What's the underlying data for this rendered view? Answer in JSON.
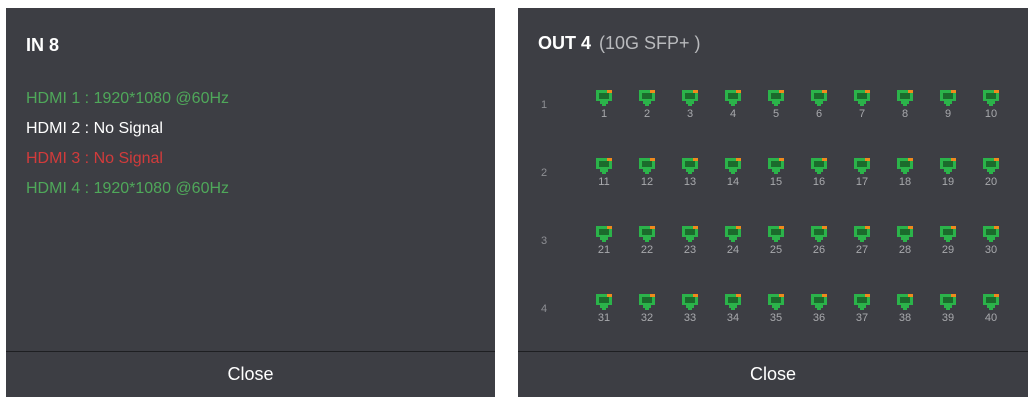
{
  "in_panel": {
    "title": "IN 8",
    "inputs": [
      {
        "label": "HDMI 1 : 1920*1080 @60Hz",
        "color": "#4fa85a"
      },
      {
        "label": "HDMI 2 : No Signal",
        "color": "#ffffff"
      },
      {
        "label": "HDMI 3 : No Signal",
        "color": "#d23b3b"
      },
      {
        "label": "HDMI 4 : 1920*1080 @60Hz",
        "color": "#4fa85a"
      }
    ],
    "close_label": "Close"
  },
  "out_panel": {
    "title": "OUT 4",
    "subtitle": "(10G SFP+ )",
    "row_labels": [
      "1",
      "2",
      "3",
      "4"
    ],
    "ports_per_row": 10,
    "port_color": "#2bb34a",
    "port_accent_color": "#f08a1c",
    "port_icon": "ethernet-port-icon",
    "ports": [
      "1",
      "2",
      "3",
      "4",
      "5",
      "6",
      "7",
      "8",
      "9",
      "10",
      "11",
      "12",
      "13",
      "14",
      "15",
      "16",
      "17",
      "18",
      "19",
      "20",
      "21",
      "22",
      "23",
      "24",
      "25",
      "26",
      "27",
      "28",
      "29",
      "30",
      "31",
      "32",
      "33",
      "34",
      "35",
      "36",
      "37",
      "38",
      "39",
      "40"
    ],
    "close_label": "Close"
  }
}
